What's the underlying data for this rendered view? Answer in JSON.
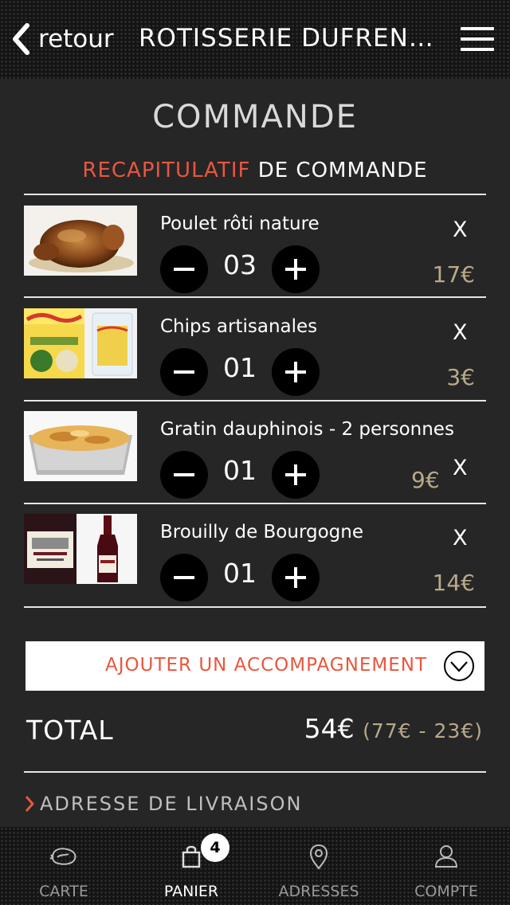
{
  "header": {
    "back_label": "retour",
    "title": "ROTISSERIE DUFRENOY",
    "menu_icon": "hamburger-menu-icon"
  },
  "page": {
    "title": "COMMANDE",
    "subtitle_red": "RECAPITULATIF",
    "subtitle_white": "DE COMMANDE"
  },
  "items": [
    {
      "name": "Poulet rôti nature",
      "qty": "03",
      "price": "17€",
      "remove": "X"
    },
    {
      "name": "Chips artisanales",
      "qty": "01",
      "price": "3€",
      "remove": "X"
    },
    {
      "name": "Gratin dauphinois - 2 personnes",
      "qty": "01",
      "price": "9€",
      "remove": "X"
    },
    {
      "name": "Brouilly de Bourgogne",
      "qty": "01",
      "price": "14€",
      "remove": "X"
    }
  ],
  "accompaniment": {
    "label": "AJOUTER UN ACCOMPAGNEMENT",
    "icon": "chevron-down-circle-icon"
  },
  "total": {
    "label": "TOTAL",
    "value": "54€",
    "detail": "(77€ - 23€)"
  },
  "delivery": {
    "label": "ADRESSE DE LIVRAISON",
    "icon": "chevron-right-icon"
  },
  "tabs": [
    {
      "label": "CARTE",
      "icon": "chicken-icon",
      "active": false
    },
    {
      "label": "PANIER",
      "icon": "shopping-bag-icon",
      "active": true,
      "badge": "4"
    },
    {
      "label": "ADRESSES",
      "icon": "location-pin-icon",
      "active": false
    },
    {
      "label": "COMPTE",
      "icon": "user-icon",
      "active": false
    }
  ],
  "colors": {
    "accent": "#e8573f",
    "price": "#b8a98a",
    "background": "#262626"
  }
}
